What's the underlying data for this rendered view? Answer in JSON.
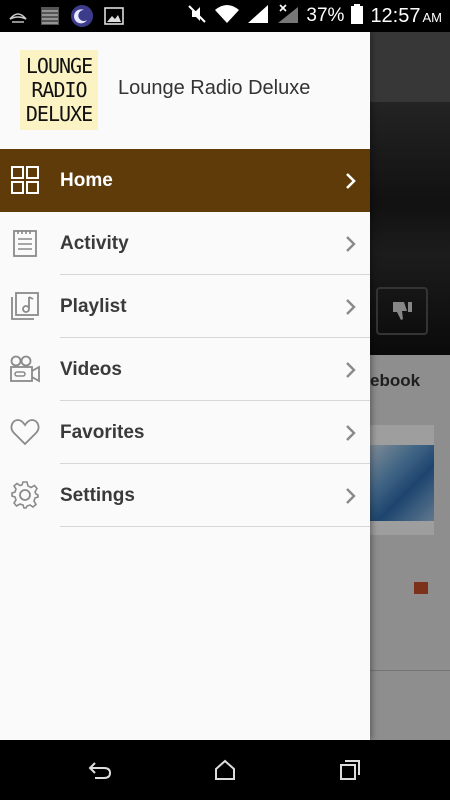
{
  "status_bar": {
    "battery": "37%",
    "time": "12:57",
    "ampm": "AM"
  },
  "drawer": {
    "logo_lines": [
      "LOUNGE",
      "RADIO",
      "DELUXE"
    ],
    "app_name": "Lounge Radio Deluxe",
    "active_color": "#5e3b09",
    "items": [
      {
        "label": "Home",
        "icon": "grid-icon",
        "active": true
      },
      {
        "label": "Activity",
        "icon": "notepad-icon",
        "active": false
      },
      {
        "label": "Playlist",
        "icon": "music-note-icon",
        "active": false
      },
      {
        "label": "Videos",
        "icon": "video-camera-icon",
        "active": false
      },
      {
        "label": "Favorites",
        "icon": "heart-icon",
        "active": false
      },
      {
        "label": "Settings",
        "icon": "gear-icon",
        "active": false
      }
    ]
  },
  "background_app": {
    "card_title_fragment": "ebook"
  }
}
